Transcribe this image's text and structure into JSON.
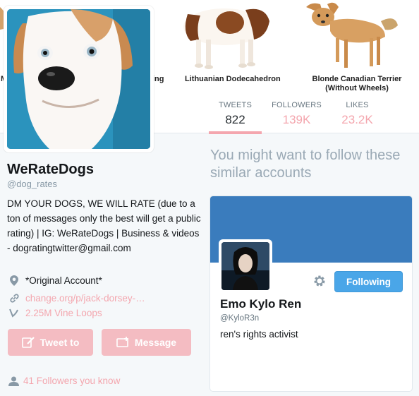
{
  "banner": {
    "labels": [
      "ing",
      "Lithuanian Dodecahedron",
      "Blonde Canadian Terrier\n(Without Wheels)"
    ],
    "left_fragment": "M"
  },
  "stats": {
    "tweets": {
      "label": "TWEETS",
      "value": "822"
    },
    "followers": {
      "label": "FOLLOWERS",
      "value": "139K"
    },
    "likes": {
      "label": "LIKES",
      "value": "23.2K"
    }
  },
  "profile": {
    "name": "WeRateDogs",
    "handle": "@dog_rates",
    "bio": "DM YOUR DOGS, WE WILL RATE (due to a ton of messages only the best will get a public rating) | IG: WeRateDogs | Business & videos - dogratingtwitter@gmail.com",
    "location": "*Original Account*",
    "link": "change.org/p/jack-dorsey-…",
    "vine": "2.25M Vine Loops",
    "tweet_to": "Tweet to",
    "message": "Message",
    "followers_you_know": "41 Followers you know"
  },
  "who_to_follow": {
    "title": "You might want to follow these similar accounts",
    "card": {
      "name": "Emo Kylo Ren",
      "handle": "@KyloR3n",
      "bio": "ren's rights activist",
      "follow_label": "Following"
    }
  },
  "colors": {
    "accent_pink": "#f4a6ae",
    "button_pink": "#f4bcc2",
    "card_header_blue": "#3a7cbd",
    "follow_blue": "#4aa6e8"
  },
  "icons": [
    "map-pin-icon",
    "link-icon",
    "vine-icon",
    "compose-icon",
    "message-icon",
    "person-icon",
    "gear-icon"
  ]
}
